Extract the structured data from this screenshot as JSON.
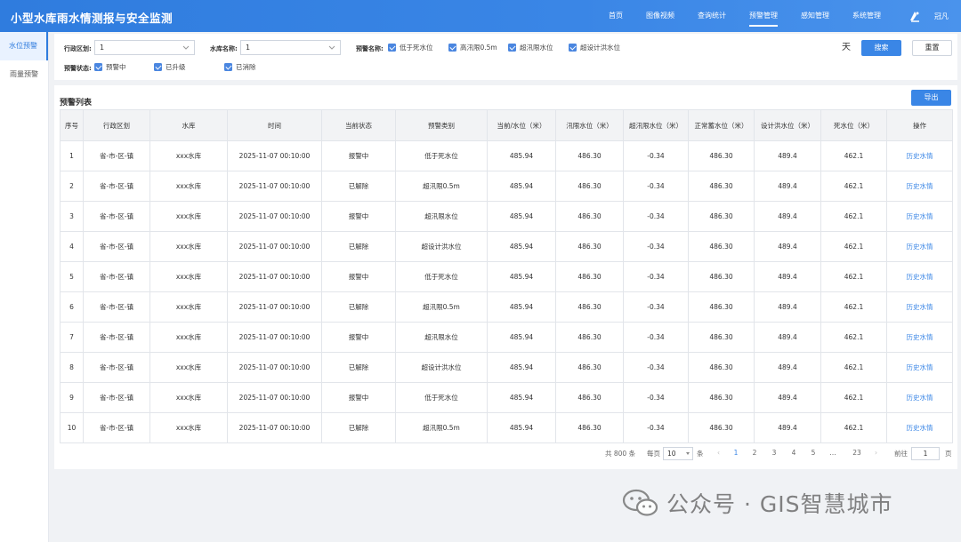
{
  "app": {
    "title": "小型水库雨水情测报与安全监测"
  },
  "nav": {
    "items": [
      {
        "label": "首页",
        "active": false
      },
      {
        "label": "图像视频",
        "active": false
      },
      {
        "label": "查询统计",
        "active": false
      },
      {
        "label": "预警管理",
        "active": true
      },
      {
        "label": "感知管理",
        "active": false
      },
      {
        "label": "系统管理",
        "active": false
      }
    ],
    "user_name": "冠凡"
  },
  "sidebar": {
    "items": [
      {
        "label": "水位预警",
        "active": true
      },
      {
        "label": "雨量预警",
        "active": false
      }
    ]
  },
  "filters": {
    "region_label": "行政区划:",
    "region_value": "1",
    "reservoir_label": "水库名称:",
    "reservoir_value": "1",
    "warning_name_label": "预警名称:",
    "warning_names": [
      "低于死水位",
      "高汛限0.5m",
      "超汛限水位",
      "超设计洪水位"
    ],
    "status_label": "预警状态:",
    "statuses": [
      "预警中",
      "已升级",
      "已消除"
    ],
    "collapse_icon_glyph": "天",
    "search_label": "搜索",
    "reset_label": "重置"
  },
  "table": {
    "title": "预警列表",
    "export_label": "导出",
    "columns": [
      "序号",
      "行政区划",
      "水库",
      "时间",
      "当前状态",
      "预警类别",
      "当前/水位（米）",
      "汛限水位（米）",
      "超汛限水位（米）",
      "正常蓄水位（米）",
      "设计洪水位（米）",
      "死水位（米）",
      "操作"
    ],
    "rows": [
      [
        "1",
        "省-市-区-镇",
        "xxx水库",
        "2025-11-07 00:10:00",
        "报警中",
        "低于死水位",
        "485.94",
        "486.30",
        "-0.34",
        "486.30",
        "489.4",
        "462.1",
        "历史水情"
      ],
      [
        "2",
        "省-市-区-镇",
        "xxx水库",
        "2025-11-07 00:10:00",
        "已解除",
        "超汛限0.5m",
        "485.94",
        "486.30",
        "-0.34",
        "486.30",
        "489.4",
        "462.1",
        "历史水情"
      ],
      [
        "3",
        "省-市-区-镇",
        "xxx水库",
        "2025-11-07 00:10:00",
        "报警中",
        "超汛限水位",
        "485.94",
        "486.30",
        "-0.34",
        "486.30",
        "489.4",
        "462.1",
        "历史水情"
      ],
      [
        "4",
        "省-市-区-镇",
        "xxx水库",
        "2025-11-07 00:10:00",
        "已解除",
        "超设计洪水位",
        "485.94",
        "486.30",
        "-0.34",
        "486.30",
        "489.4",
        "462.1",
        "历史水情"
      ],
      [
        "5",
        "省-市-区-镇",
        "xxx水库",
        "2025-11-07 00:10:00",
        "报警中",
        "低于死水位",
        "485.94",
        "486.30",
        "-0.34",
        "486.30",
        "489.4",
        "462.1",
        "历史水情"
      ],
      [
        "6",
        "省-市-区-镇",
        "xxx水库",
        "2025-11-07 00:10:00",
        "已解除",
        "超汛限0.5m",
        "485.94",
        "486.30",
        "-0.34",
        "486.30",
        "489.4",
        "462.1",
        "历史水情"
      ],
      [
        "7",
        "省-市-区-镇",
        "xxx水库",
        "2025-11-07 00:10:00",
        "报警中",
        "超汛限水位",
        "485.94",
        "486.30",
        "-0.34",
        "486.30",
        "489.4",
        "462.1",
        "历史水情"
      ],
      [
        "8",
        "省-市-区-镇",
        "xxx水库",
        "2025-11-07 00:10:00",
        "已解除",
        "超设计洪水位",
        "485.94",
        "486.30",
        "-0.34",
        "486.30",
        "489.4",
        "462.1",
        "历史水情"
      ],
      [
        "9",
        "省-市-区-镇",
        "xxx水库",
        "2025-11-07 00:10:00",
        "报警中",
        "低于死水位",
        "485.94",
        "486.30",
        "-0.34",
        "486.30",
        "489.4",
        "462.1",
        "历史水情"
      ],
      [
        "10",
        "省-市-区-镇",
        "xxx水库",
        "2025-11-07 00:10:00",
        "已解除",
        "超汛限0.5m",
        "485.94",
        "486.30",
        "-0.34",
        "486.30",
        "489.4",
        "462.1",
        "历史水情"
      ]
    ]
  },
  "pagination": {
    "total_text": "共 800 条",
    "per_page_label": "每页",
    "per_page_value": "10",
    "per_page_unit": "条",
    "prev": "‹",
    "pages": [
      "1",
      "2",
      "3",
      "4",
      "5",
      "…",
      "23"
    ],
    "current_page": "1",
    "next": "›",
    "goto_label": "前往",
    "goto_value": "1",
    "goto_unit": "页"
  },
  "watermark": {
    "text": "公众号 · GIS智慧城市"
  },
  "colors": {
    "primary": "#3a86e6",
    "header": "#2f7cde",
    "link": "#3a86e6"
  }
}
